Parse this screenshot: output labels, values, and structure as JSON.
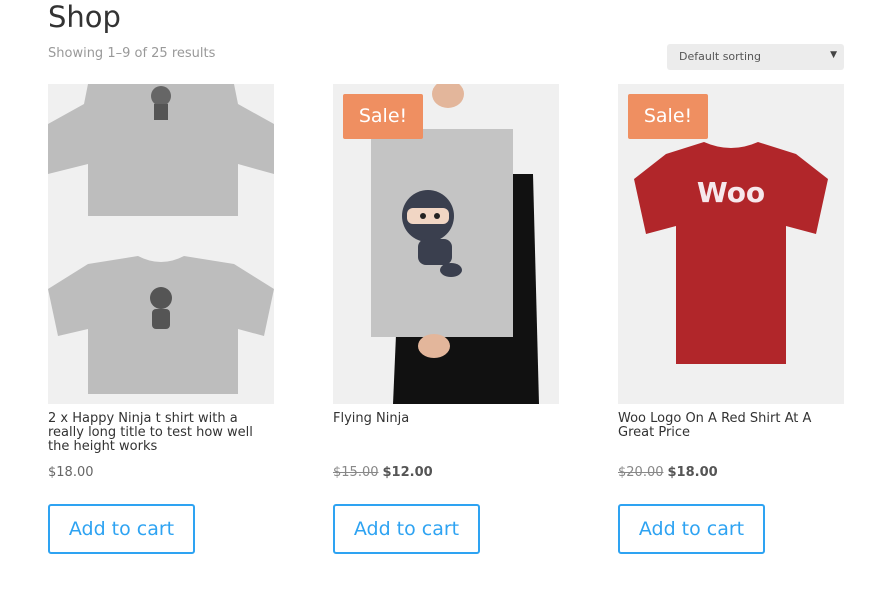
{
  "page": {
    "title": "Shop",
    "result_count": "Showing 1–9 of 25 results",
    "sorting": {
      "selected": "Default sorting"
    }
  },
  "products": [
    {
      "title": "2 x Happy Ninja t shirt with a really long title to test how well the height works",
      "price": "$18.00",
      "add_to_cart": "Add to cart",
      "image": "ninja-tshirts-icon"
    },
    {
      "title": "Flying Ninja",
      "sale_badge": "Sale!",
      "old_price": "$15.00",
      "price": "$12.00",
      "add_to_cart": "Add to cart",
      "image": "ninja-poster-icon"
    },
    {
      "title": "Woo Logo On A Red Shirt At A Great Price",
      "sale_badge": "Sale!",
      "old_price": "$20.00",
      "price": "$18.00",
      "add_to_cart": "Add to cart",
      "image": "red-woo-shirt-icon",
      "shirt_text": "Woo"
    }
  ],
  "colors": {
    "accent": "#2ea3f2",
    "sale_badge": "#ef8f61",
    "shirt_red": "#b1262a"
  }
}
